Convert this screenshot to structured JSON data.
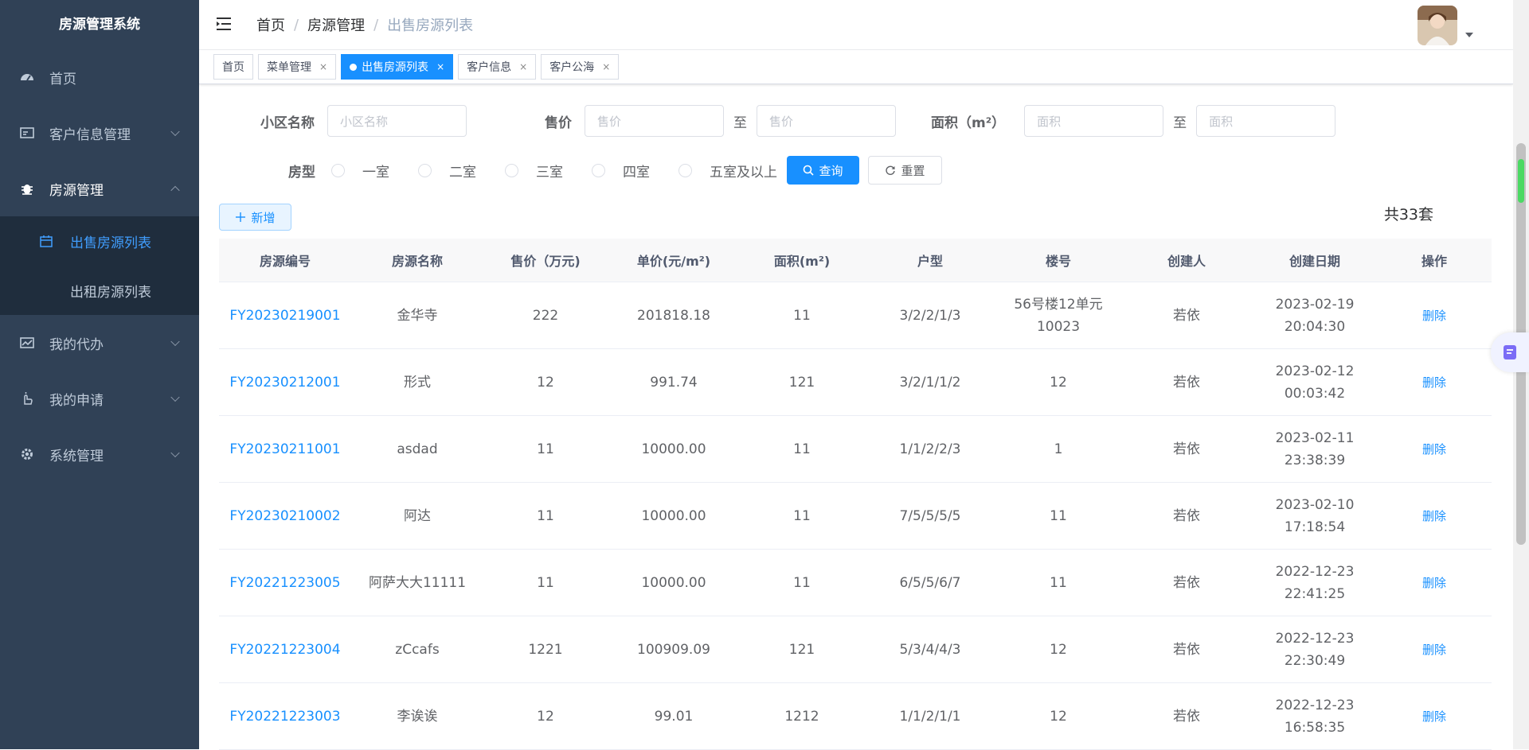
{
  "app": {
    "title": "房源管理系统"
  },
  "sidebar": {
    "items": [
      {
        "label": "首页"
      },
      {
        "label": "客户信息管理"
      },
      {
        "label": "房源管理"
      },
      {
        "label": "我的代办"
      },
      {
        "label": "我的申请"
      },
      {
        "label": "系统管理"
      }
    ],
    "sub": [
      {
        "label": "出售房源列表"
      },
      {
        "label": "出租房源列表"
      }
    ]
  },
  "header": {
    "breadcrumb": [
      "首页",
      "房源管理",
      "出售房源列表"
    ],
    "separator": "/"
  },
  "tags": [
    {
      "label": "首页"
    },
    {
      "label": "菜单管理",
      "close": "×"
    },
    {
      "label": "出售房源列表",
      "close": "×"
    },
    {
      "label": "客户信息",
      "close": "×"
    },
    {
      "label": "客户公海",
      "close": "×"
    }
  ],
  "search": {
    "community_label": "小区名称",
    "community_placeholder": "小区名称",
    "price_label": "售价",
    "price_min_placeholder": "售价",
    "price_to": "至",
    "price_max_placeholder": "售价",
    "area_label": "面积（m²）",
    "area_min_placeholder": "面积",
    "area_to": "至",
    "area_max_placeholder": "面积",
    "type_label": "房型",
    "type_options": [
      "一室",
      "二室",
      "三室",
      "四室",
      "五室及以上"
    ],
    "query_button": "查询",
    "reset_button": "重置"
  },
  "toolbar": {
    "add_button": "新增",
    "total": "共33套"
  },
  "table": {
    "columns": [
      "房源编号",
      "房源名称",
      "售价（万元)",
      "单价(元/m²)",
      "面积(m²)",
      "户型",
      "楼号",
      "创建人",
      "创建日期",
      "操作"
    ],
    "rows": [
      {
        "id": "FY20230219001",
        "name": "金华寺",
        "price": "222",
        "unit": "201818.18",
        "area": "11",
        "layout": "3/2/2/1/3",
        "building": "56号楼12单元10023",
        "creator": "若依",
        "date": "2023-02-19 20:04:30",
        "action": "删除"
      },
      {
        "id": "FY20230212001",
        "name": "形式",
        "price": "12",
        "unit": "991.74",
        "area": "121",
        "layout": "3/2/1/1/2",
        "building": "12",
        "creator": "若依",
        "date": "2023-02-12 00:03:42",
        "action": "删除"
      },
      {
        "id": "FY20230211001",
        "name": "asdad",
        "price": "11",
        "unit": "10000.00",
        "area": "11",
        "layout": "1/1/2/2/3",
        "building": "1",
        "creator": "若依",
        "date": "2023-02-11 23:38:39",
        "action": "删除"
      },
      {
        "id": "FY20230210002",
        "name": "阿达",
        "price": "11",
        "unit": "10000.00",
        "area": "11",
        "layout": "7/5/5/5/5",
        "building": "11",
        "creator": "若依",
        "date": "2023-02-10 17:18:54",
        "action": "删除"
      },
      {
        "id": "FY20221223005",
        "name": "阿萨大大11111",
        "price": "11",
        "unit": "10000.00",
        "area": "11",
        "layout": "6/5/5/6/7",
        "building": "11",
        "creator": "若依",
        "date": "2022-12-23 22:41:25",
        "action": "删除"
      },
      {
        "id": "FY20221223004",
        "name": "zCcafs",
        "price": "1221",
        "unit": "100909.09",
        "area": "121",
        "layout": "5/3/4/4/3",
        "building": "12",
        "creator": "若依",
        "date": "2022-12-23 22:30:49",
        "action": "删除"
      },
      {
        "id": "FY20221223003",
        "name": "李诶诶",
        "price": "12",
        "unit": "99.01",
        "area": "1212",
        "layout": "1/1/2/1/1",
        "building": "12",
        "creator": "若依",
        "date": "2022-12-23 16:58:35",
        "action": "删除"
      }
    ]
  },
  "colors": {
    "sidebar_bg": "#304156",
    "submenu_bg": "#1f2d3d",
    "primary": "#1890ff"
  },
  "icons": [
    "dashboard-icon",
    "card-icon",
    "bug-icon",
    "calendar-icon",
    "chart-icon",
    "hand-icon",
    "gear-icon",
    "hamburger-icon",
    "search-icon",
    "refresh-icon",
    "plus-icon"
  ]
}
